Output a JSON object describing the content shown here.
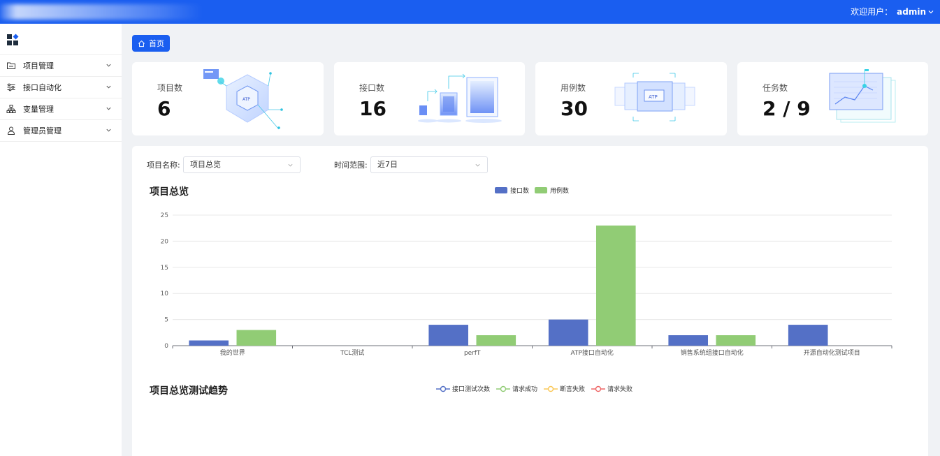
{
  "header": {
    "welcome_label": "欢迎用户：",
    "username": "admin"
  },
  "sidebar": {
    "items": [
      {
        "label": "项目管理",
        "icon": "folder-icon"
      },
      {
        "label": "接口自动化",
        "icon": "sliders-icon"
      },
      {
        "label": "变量管理",
        "icon": "hierarchy-icon"
      },
      {
        "label": "管理员管理",
        "icon": "user-icon"
      }
    ]
  },
  "breadcrumb": {
    "home_label": "首页"
  },
  "stats": [
    {
      "label": "项目数",
      "value": "6"
    },
    {
      "label": "接口数",
      "value": "16"
    },
    {
      "label": "用例数",
      "value": "30"
    },
    {
      "label": "任务数",
      "value": "2 / 9"
    }
  ],
  "filters": {
    "project_label": "项目名称:",
    "project_value": "项目总览",
    "time_label": "时间范围:",
    "time_value": "近7日"
  },
  "overview": {
    "title": "项目总览"
  },
  "trend": {
    "title": "项目总览测试趋势",
    "legend": [
      {
        "name": "接口测试次数",
        "color": "#5470c6"
      },
      {
        "name": "请求成功",
        "color": "#91cc75"
      },
      {
        "name": "断言失败",
        "color": "#fac858"
      },
      {
        "name": "请求失败",
        "color": "#ee6666"
      }
    ]
  },
  "chart_data": {
    "type": "bar",
    "categories": [
      "我的世界",
      "TCL测试",
      "perfT",
      "ATP接口自动化",
      "销售系统组接口自动化",
      "开源自动化测试项目"
    ],
    "series": [
      {
        "name": "接口数",
        "color": "#5470c6",
        "values": [
          1,
          0,
          4,
          5,
          2,
          4
        ]
      },
      {
        "name": "用例数",
        "color": "#91cc75",
        "values": [
          3,
          0,
          2,
          23,
          2,
          0
        ]
      }
    ],
    "ylim": [
      0,
      25
    ],
    "yticks": [
      0,
      5,
      10,
      15,
      20,
      25
    ],
    "legend_position": "top-center",
    "grid": true
  }
}
